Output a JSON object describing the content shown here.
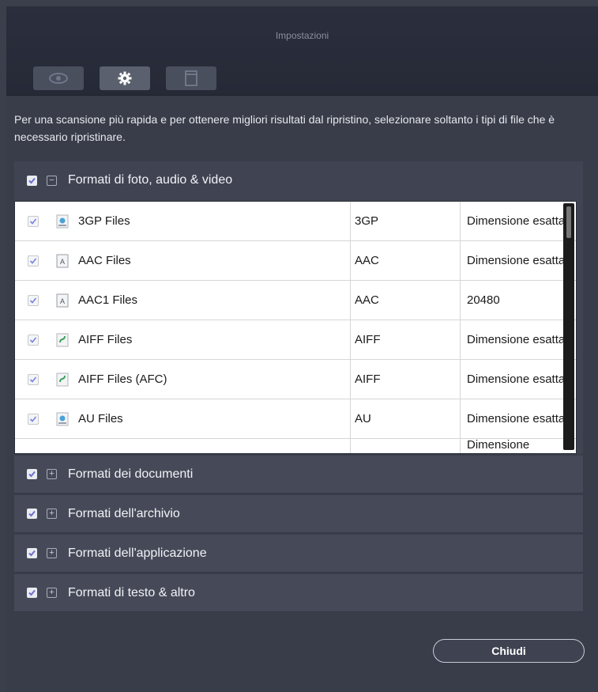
{
  "window": {
    "title": "Impostazioni"
  },
  "toolbar": {
    "buttons": [
      {
        "icon": "eye-icon"
      },
      {
        "icon": "gear-icon"
      },
      {
        "icon": "document-icon"
      }
    ]
  },
  "intro_text": "Per una scansione più rapida e per ottenere migliori risultati dal ripristino, selezionare soltanto i tipi di file che è necessario ripristinare.",
  "groups": [
    {
      "label": "Formati di foto, audio & video",
      "expanded": true,
      "checked": true,
      "rows": [
        {
          "name": "3GP Files",
          "type": "3GP",
          "size": "Dimensione esatta",
          "checked": true
        },
        {
          "name": "AAC Files",
          "type": "AAC",
          "size": "Dimensione esatta",
          "checked": true
        },
        {
          "name": "AAC1 Files",
          "type": "AAC",
          "size": "20480",
          "checked": true
        },
        {
          "name": "AIFF Files",
          "type": "AIFF",
          "size": "Dimensione esatta",
          "checked": true
        },
        {
          "name": "AIFF Files (AFC)",
          "type": "AIFF",
          "size": "Dimensione esatta",
          "checked": true
        },
        {
          "name": "AU Files",
          "type": "AU",
          "size": "Dimensione esatta",
          "checked": true
        },
        {
          "name": "",
          "type": "",
          "size": "Dimensione",
          "checked": false
        }
      ]
    },
    {
      "label": "Formati dei documenti",
      "expanded": false,
      "checked": true
    },
    {
      "label": "Formati dell'archivio",
      "expanded": false,
      "checked": true
    },
    {
      "label": "Formati dell'applicazione",
      "expanded": false,
      "checked": true
    },
    {
      "label": "Formati di testo & altro",
      "expanded": false,
      "checked": true
    }
  ],
  "close_button": "Chiudi",
  "colors": {
    "background": "#393d49",
    "titlebar": "#262a37",
    "accent_check": "#6b6fd0"
  }
}
